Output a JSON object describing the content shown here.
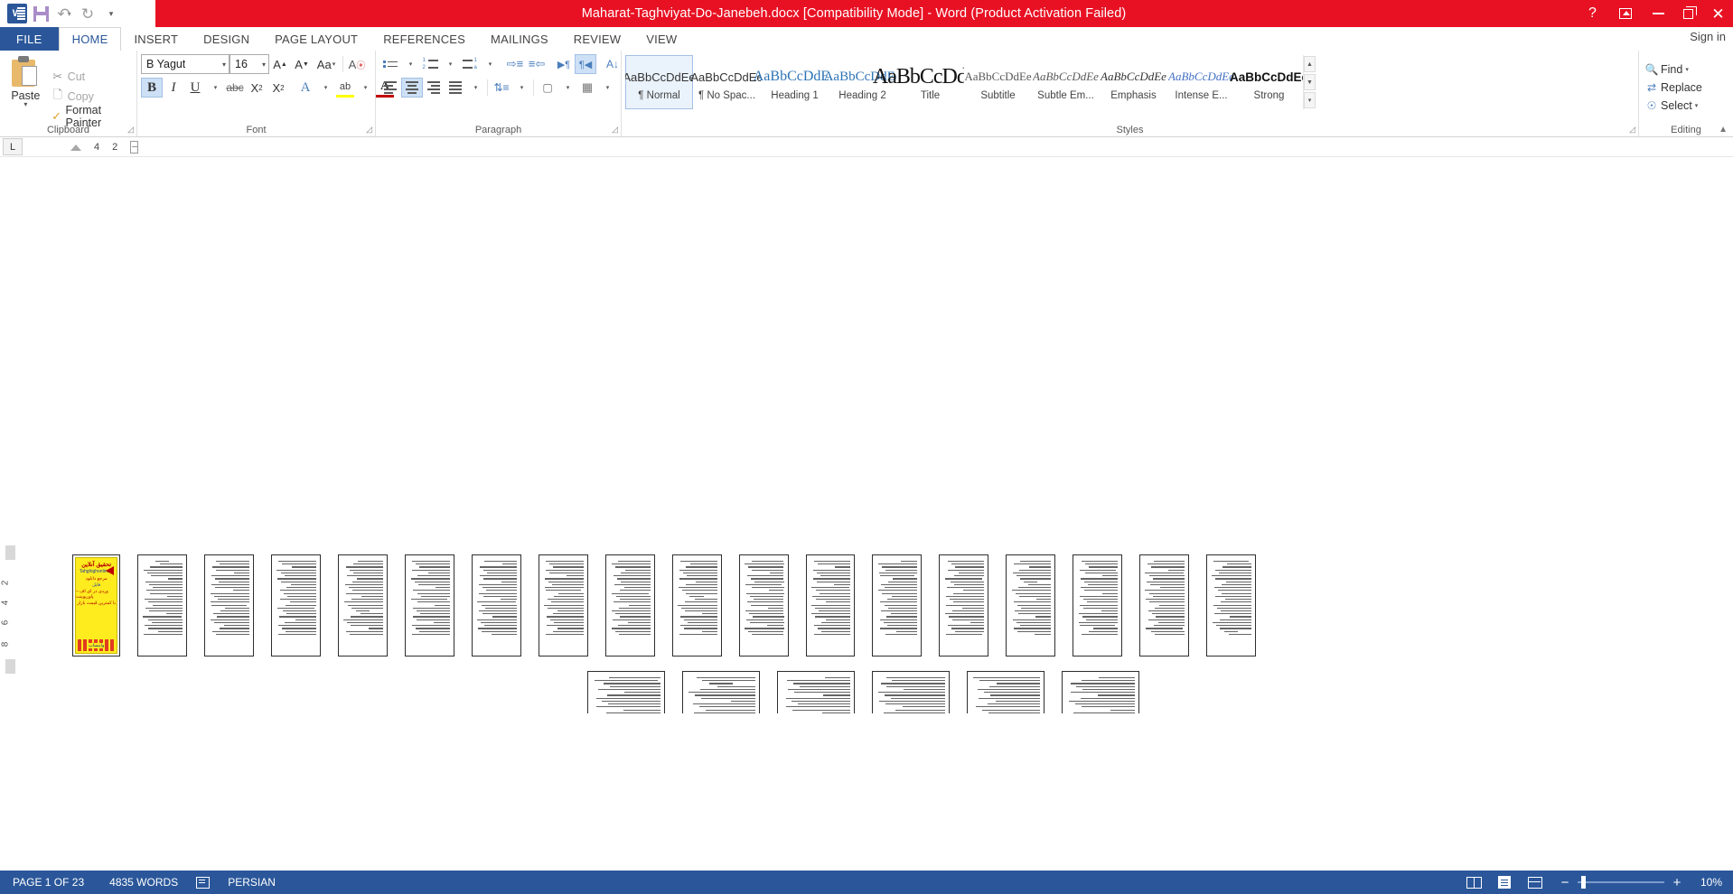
{
  "titlebar": {
    "document_title": "Maharat-Taghviyat-Do-Janebeh.docx [Compatibility Mode]  -  Word (Product Activation Failed)",
    "quick_access": [
      {
        "name": "word-logo",
        "label": "W"
      },
      {
        "name": "save",
        "label": "Save"
      },
      {
        "name": "undo",
        "label": "Undo"
      },
      {
        "name": "redo",
        "label": "Redo"
      },
      {
        "name": "customize-qat",
        "label": "Customize Quick Access Toolbar"
      }
    ],
    "window_controls": [
      {
        "name": "help",
        "label": "?"
      },
      {
        "name": "ribbon-display-options",
        "label": "Ribbon Display Options"
      },
      {
        "name": "minimize",
        "label": "Minimize"
      },
      {
        "name": "restore",
        "label": "Restore Down"
      },
      {
        "name": "close",
        "label": "✕"
      }
    ]
  },
  "tabs": {
    "file": "FILE",
    "items": [
      "HOME",
      "INSERT",
      "DESIGN",
      "PAGE LAYOUT",
      "REFERENCES",
      "MAILINGS",
      "REVIEW",
      "VIEW"
    ],
    "active": "HOME",
    "sign_in": "Sign in"
  },
  "ribbon": {
    "clipboard": {
      "group_label": "Clipboard",
      "paste": "Paste",
      "cut": "Cut",
      "copy": "Copy",
      "format_painter": "Format Painter"
    },
    "font": {
      "group_label": "Font",
      "font_name": "B Yagut",
      "font_size": "16",
      "buttons": [
        "Grow Font",
        "Shrink Font",
        "Change Case",
        "Clear All Formatting",
        "Bold",
        "Italic",
        "Underline",
        "Strikethrough",
        "Subscript",
        "Superscript",
        "Text Effects and Typography",
        "Text Highlight Color",
        "Font Color"
      ],
      "bold_active": true,
      "highlight_color": "#ffff00",
      "font_color": "#c00000"
    },
    "paragraph": {
      "group_label": "Paragraph",
      "buttons": [
        "Bullets",
        "Numbering",
        "Multilevel List",
        "Decrease Indent",
        "Increase Indent",
        "Left-to-Right Text Direction",
        "Right-to-Left Text Direction",
        "Sort",
        "Show/Hide ¶",
        "Align Left",
        "Center",
        "Align Right",
        "Justify",
        "Line and Paragraph Spacing",
        "Shading",
        "Borders"
      ],
      "center_active": true,
      "rtl_active": true,
      "showhide_active": true
    },
    "styles": {
      "group_label": "Styles",
      "items": [
        {
          "preview": "AaBbCcDdEe",
          "name": "¶ Normal",
          "selected": true
        },
        {
          "preview": "AaBbCcDdEe",
          "name": "¶ No Spac...",
          "selected": false
        },
        {
          "preview": "AaBbCcDdEe",
          "name": "Heading 1",
          "selected": false
        },
        {
          "preview": "AaBbCcDdEe",
          "name": "Heading 2",
          "selected": false
        },
        {
          "preview": "AaBbCcDdEe",
          "name": "Title",
          "selected": false
        },
        {
          "preview": "AaBbCcDdEe",
          "name": "Subtitle",
          "selected": false
        },
        {
          "preview": "AaBbCcDdEe",
          "name": "Subtle Em...",
          "selected": false
        },
        {
          "preview": "AaBbCcDdEe",
          "name": "Emphasis",
          "selected": false
        },
        {
          "preview": "AaBbCcDdEe",
          "name": "Intense E...",
          "selected": false
        },
        {
          "preview": "AaBbCcDdEe",
          "name": "Strong",
          "selected": false
        }
      ],
      "scroll_up": "▲",
      "scroll_down": "▼",
      "more": "▾"
    },
    "editing": {
      "group_label": "Editing",
      "find": "Find",
      "replace": "Replace",
      "select": "Select"
    },
    "collapse": "Collapse the Ribbon"
  },
  "ruler": {
    "tab_stop_label": "L",
    "marks": [
      "4",
      "2"
    ],
    "vertical_marks": [
      "2",
      "4",
      "6",
      "8"
    ]
  },
  "document": {
    "cover_page": {
      "line1": "تحقیق آنلاین",
      "line2": "Tahghighonline.ir",
      "line3": "مرجع دانلود",
      "line4": "فایل",
      "line5": "وردی در ای اف – پاورپوینت",
      "line6": "با کمترین قیمت بازار",
      "strip": "واینساپ"
    },
    "row1_page_count": 18,
    "row2_page_count": 6,
    "total_thumbnails": 24
  },
  "statusbar": {
    "page_indicator": "PAGE 1 OF 23",
    "word_count": "4835 WORDS",
    "proofing": "Proofing errors",
    "language": "PERSIAN",
    "views": [
      "Read Mode",
      "Print Layout",
      "Web Layout"
    ],
    "zoom_out": "−",
    "zoom_in": "+",
    "zoom_level": "10%"
  }
}
